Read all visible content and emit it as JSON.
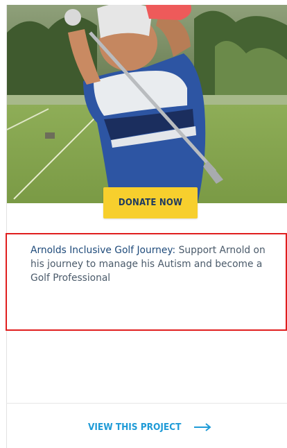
{
  "card": {
    "image_alt": "Arnold golf swing",
    "donate_label": "DONATE NOW",
    "title": "Arnolds Inclusive Golf Journey:",
    "description": " Support Arnold on his journey to manage his Autism and become a Golf Professional",
    "view_label": "VIEW THIS PROJECT",
    "arrow_icon": "arrow-right-icon"
  },
  "colors": {
    "button_bg": "#f7cf2d",
    "button_text": "#1e3a5f",
    "link": "#1f9bd7",
    "highlight_border": "#e01e1e"
  }
}
